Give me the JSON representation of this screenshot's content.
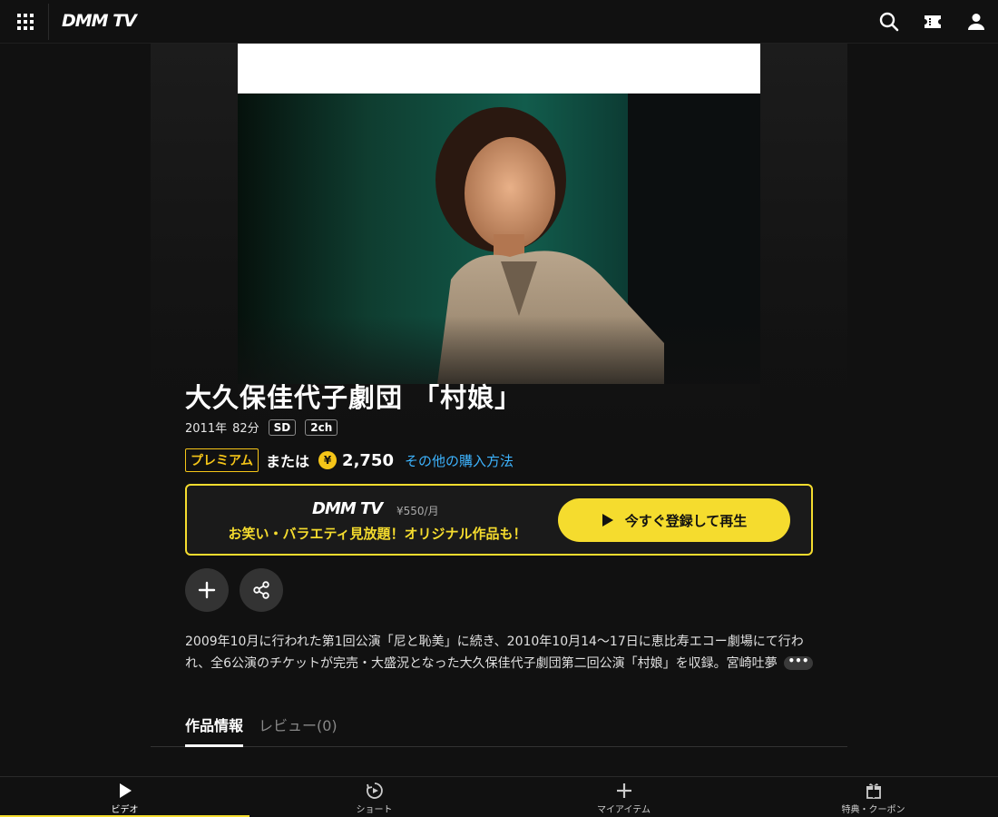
{
  "header": {
    "logo": "DMM TV",
    "icons": [
      "apps-grid-icon",
      "search-icon",
      "ticket-icon",
      "user-icon"
    ]
  },
  "content": {
    "title": "大久保佳代子劇団 「村娘」",
    "year": "2011年",
    "duration": "82分",
    "badges": [
      "SD",
      "2ch"
    ],
    "premium_label": "プレミアム",
    "or_text": "または",
    "yen_symbol": "¥",
    "price": "2,750",
    "other_purchase": "その他の購入方法"
  },
  "promo": {
    "logo": "DMM TV",
    "price": "¥550/月",
    "tagline": "お笑い・バラエティ見放題！オリジナル作品も！",
    "cta": "今すぐ登録して再生"
  },
  "actions": {
    "add_icon": "plus-icon",
    "share_icon": "share-icon"
  },
  "description": {
    "text": "2009年10月に行われた第1回公演「尼と恥美」に続き、2010年10月14～17日に恵比寿エコー劇場にて行われ、全6公演のチケットが完売・大盛況となった大久保佳代子劇団第二回公演「村娘」を収録。宮崎吐夢",
    "more": "•••"
  },
  "tabs": [
    {
      "label": "作品情報",
      "active": true
    },
    {
      "label": "レビュー(0)",
      "active": false
    }
  ],
  "bottom_nav": [
    {
      "label": "ビデオ",
      "icon": "play-icon",
      "active": true
    },
    {
      "label": "ショート",
      "icon": "short-play-icon",
      "active": false
    },
    {
      "label": "マイアイテム",
      "icon": "plus-icon",
      "active": false
    },
    {
      "label": "特典・クーポン",
      "icon": "gift-icon",
      "active": false
    }
  ],
  "colors": {
    "accent_yellow": "#f5dc2e",
    "premium_yellow": "#f5c518",
    "link_blue": "#3db4ff",
    "background": "#111111"
  }
}
